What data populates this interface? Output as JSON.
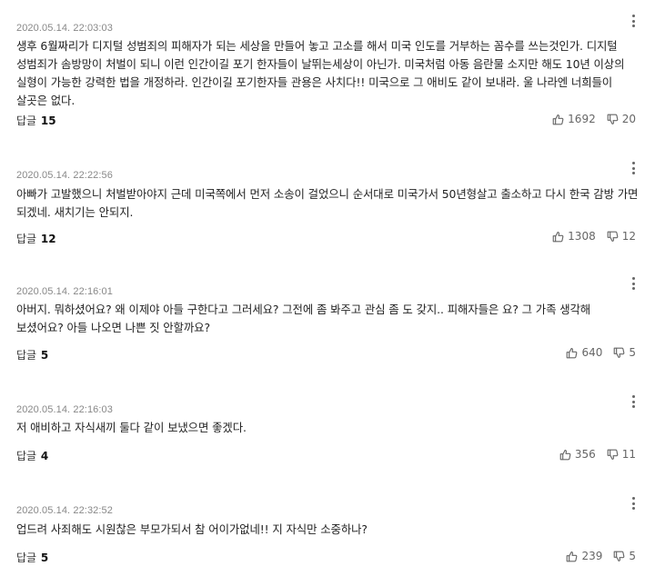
{
  "reply_label": "답글",
  "comments": [
    {
      "timestamp": "2020.05.14. 22:03:03",
      "text": "생후 6월짜리가 디지털 성범죄의 피해자가 되는 세상을 만들어 놓고 고소를 해서 미국 인도를 거부하는 꼼수를 쓰는것인가. 디지털 성범죄가 솜방망이 처벌이 되니 이런 인간이길 포기 한자들이 날뛰는세상이 아닌가. 미국처럼 아동 음란물 소지만 해도 10년 이상의 실형이 가능한 강력한 법을 개정하라. 인간이길 포기한자들 관용은 사치다!! 미국으로 그 애비도 같이 보내라. 울 나라엔 너희들이 살곳은 없다.",
      "replies": "15",
      "likes": "1692",
      "dislikes": "20"
    },
    {
      "timestamp": "2020.05.14. 22:22:56",
      "text": "아빠가 고발했으니 처벌받아야지 근데 미국쪽에서 먼저 소송이 걸었으니 순서대로 미국가서 50년형살고 출소하고 다시 한국 감방 가면 되겠네. 새치기는 안되지.",
      "replies": "12",
      "likes": "1308",
      "dislikes": "12"
    },
    {
      "timestamp": "2020.05.14. 22:16:01",
      "text": "아버지. 뭐하셨어요? 왜 이제야 아들 구한다고 그러세요? 그전에 좀 봐주고 관심 좀 도 갖지.. 피해자들은 요? 그 가족 생각해 보셨어요? 아들 나오면 나쁜 짓 안할까요?",
      "replies": "5",
      "likes": "640",
      "dislikes": "5"
    },
    {
      "timestamp": "2020.05.14. 22:16:03",
      "text": "저 애비하고 자식새끼 둘다 같이 보냈으면 좋겠다.",
      "replies": "4",
      "likes": "356",
      "dislikes": "11"
    },
    {
      "timestamp": "2020.05.14. 22:32:52",
      "text": "업드려 사죄해도 시원찮은 부모가되서 참 어이가없네!! 지 자식만 소중하나?",
      "replies": "5",
      "likes": "239",
      "dislikes": "5"
    }
  ]
}
